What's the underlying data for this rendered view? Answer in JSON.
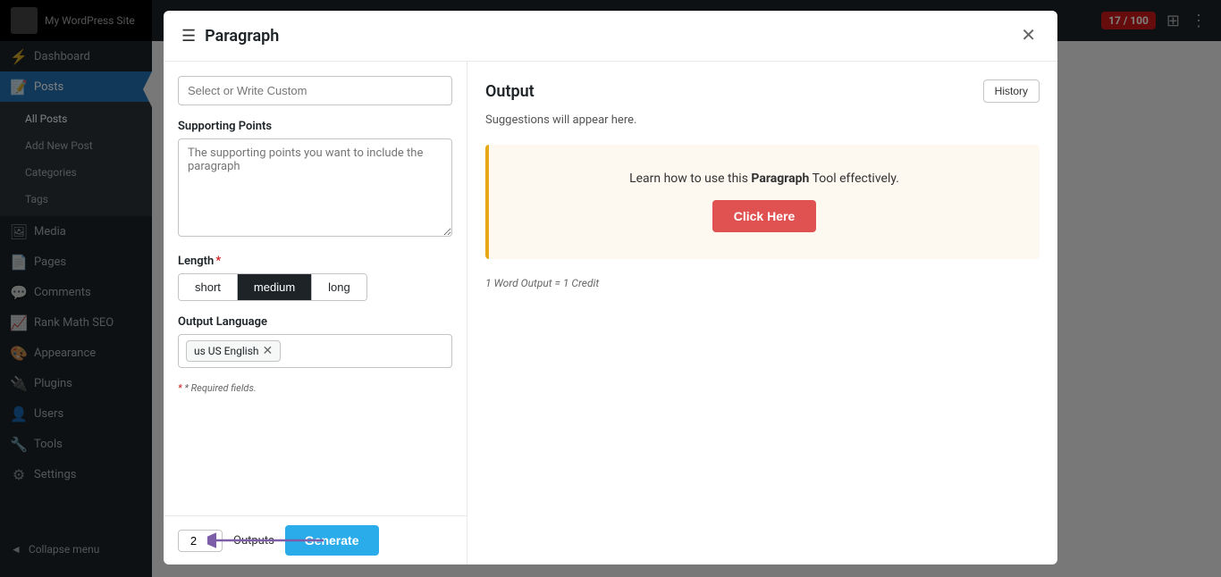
{
  "sidebar": {
    "site_name": "My WordPress Site",
    "items": [
      {
        "id": "dashboard",
        "label": "Dashboard",
        "icon": "⚡",
        "active": false
      },
      {
        "id": "posts",
        "label": "Posts",
        "icon": "📝",
        "active": true
      },
      {
        "id": "media",
        "label": "Media",
        "icon": "🖼",
        "active": false
      },
      {
        "id": "pages",
        "label": "Pages",
        "icon": "📄",
        "active": false
      },
      {
        "id": "comments",
        "label": "Comments",
        "icon": "💬",
        "active": false
      },
      {
        "id": "rank-math-seo",
        "label": "Rank Math SEO",
        "icon": "📈",
        "active": false
      },
      {
        "id": "appearance",
        "label": "Appearance",
        "icon": "🎨",
        "active": false
      },
      {
        "id": "plugins",
        "label": "Plugins",
        "icon": "🔌",
        "active": false
      },
      {
        "id": "users",
        "label": "Users",
        "icon": "👤",
        "active": false
      },
      {
        "id": "tools",
        "label": "Tools",
        "icon": "🔧",
        "active": false
      },
      {
        "id": "settings",
        "label": "Settings",
        "icon": "⚙",
        "active": false
      }
    ],
    "submenu": [
      {
        "label": "All Posts",
        "active": true
      },
      {
        "label": "Add New Post"
      },
      {
        "label": "Categories"
      },
      {
        "label": "Tags"
      }
    ],
    "collapse_label": "Collapse menu"
  },
  "topbar": {
    "badge": "17 / 100"
  },
  "modal": {
    "title": "Paragraph",
    "hamburger_icon": "☰",
    "close_icon": "✕",
    "form": {
      "select_label": "Select or Write Custom",
      "select_placeholder": "Select or Write Custom",
      "supporting_points_label": "Supporting Points",
      "supporting_points_placeholder": "The supporting points you want to include the paragraph",
      "length_label": "Length",
      "length_required": true,
      "length_options": [
        {
          "label": "short",
          "value": "short",
          "active": false
        },
        {
          "label": "medium",
          "value": "medium",
          "active": true
        },
        {
          "label": "long",
          "value": "long",
          "active": false
        }
      ],
      "output_language_label": "Output Language",
      "language_tag": "us US English",
      "required_note": "* Required fields."
    },
    "footer": {
      "count_value": "2",
      "outputs_label": "Outputs",
      "generate_label": "Generate"
    },
    "output": {
      "title": "Output",
      "history_label": "History",
      "suggestion_text": "Suggestions will appear here.",
      "info_box_text_before": "Learn how to use this ",
      "info_box_bold": "Paragraph",
      "info_box_text_after": " Tool effectively.",
      "click_here_label": "Click Here",
      "credit_note": "1 Word Output = 1 Credit"
    }
  }
}
